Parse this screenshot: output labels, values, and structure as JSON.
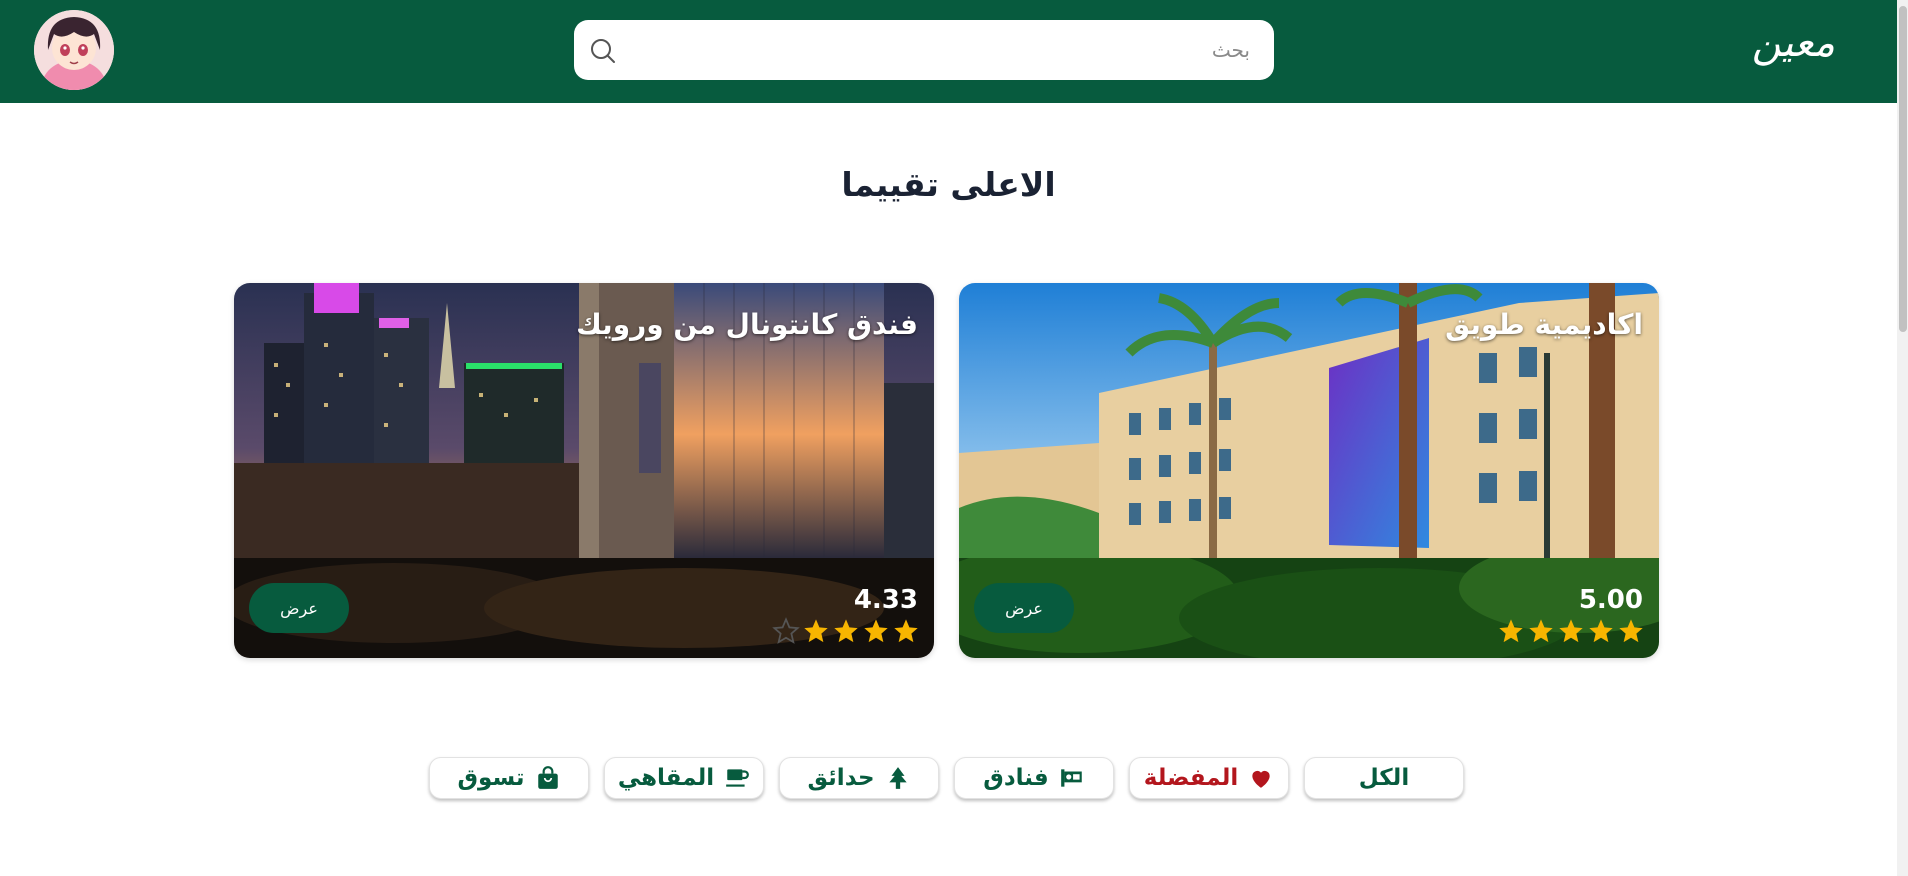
{
  "header": {
    "logo_text": "معين",
    "search": {
      "placeholder": "بحث"
    }
  },
  "section": {
    "title": "الاعلى تقييما"
  },
  "cards": [
    {
      "title": "اكاديمية طويق",
      "rating": "5.00",
      "stars": 5,
      "view_label": "عرض"
    },
    {
      "title": "فندق كانتونال من ورويك",
      "rating": "4.33",
      "stars": 4,
      "view_label": "عرض"
    }
  ],
  "filters": [
    {
      "label": "الكل",
      "icon": "none"
    },
    {
      "label": "المفضلة",
      "icon": "heart-icon"
    },
    {
      "label": "فنادق",
      "icon": "hotel-bed-icon"
    },
    {
      "label": "حدائق",
      "icon": "tree-icon"
    },
    {
      "label": "المقاهي",
      "icon": "coffee-cup-icon"
    },
    {
      "label": "تسوق",
      "icon": "shopping-bag-icon"
    }
  ],
  "colors": {
    "brand_green": "#075b3e",
    "favorite_red": "#b3161d",
    "star_gold": "#f7b500"
  }
}
